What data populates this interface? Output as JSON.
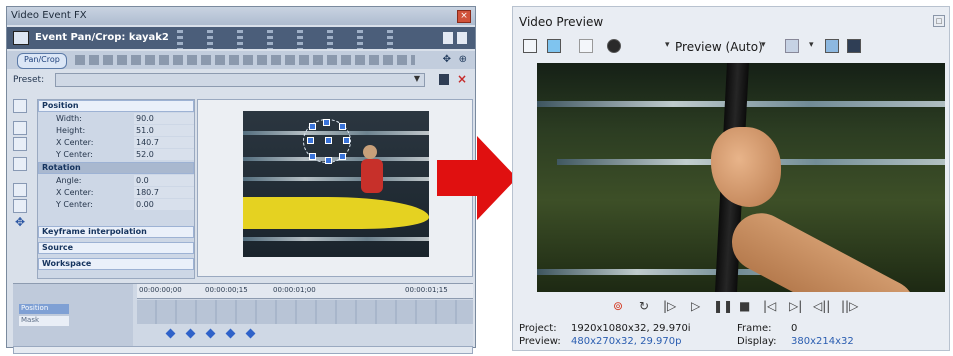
{
  "fx_window": {
    "title": "Video Event FX",
    "close_glyph": "×",
    "plugin_name": "Event Pan/Crop: kayak2",
    "chain_tab": "Pan/Crop",
    "preset_label": "Preset:",
    "params": {
      "position_header": "Position",
      "width_label": "Width:",
      "width_value": "90.0",
      "height_label": "Height:",
      "height_value": "51.0",
      "xcenter_label": "X Center:",
      "xcenter_value": "140.7",
      "ycenter_label": "Y Center:",
      "ycenter_value": "52.0",
      "rotation_header": "Rotation",
      "angle_label": "Angle:",
      "angle_value": "0.0",
      "rxcenter_label": "X Center:",
      "rxcenter_value": "180.7",
      "rycenter_label": "Y Center:",
      "rycenter_value": "0.00",
      "keyframe_header": "Keyframe interpolation",
      "source_header": "Source",
      "workspace_header": "Workspace"
    },
    "timeline": {
      "position_label": "Position",
      "mask_label": "Mask",
      "ticks": [
        "00:00:00;00",
        "00:00:00;15",
        "00:00:01;00",
        "00:00:01;15"
      ]
    }
  },
  "video_preview": {
    "title": "Video Preview",
    "close_glyph": "□",
    "quality": "Preview (Auto)",
    "dropdown_glyph": "▾",
    "project_label": "Project:",
    "project_value": "1920x1080x32, 29.970i",
    "preview_label": "Preview:",
    "preview_value": "480x270x32, 29.970p",
    "frame_label": "Frame:",
    "frame_value": "0",
    "display_label": "Display:",
    "display_value": "380x214x32"
  },
  "colors": {
    "arrow": "#e01010",
    "accent_blue": "#2a5db0",
    "record": "#d33a22"
  }
}
